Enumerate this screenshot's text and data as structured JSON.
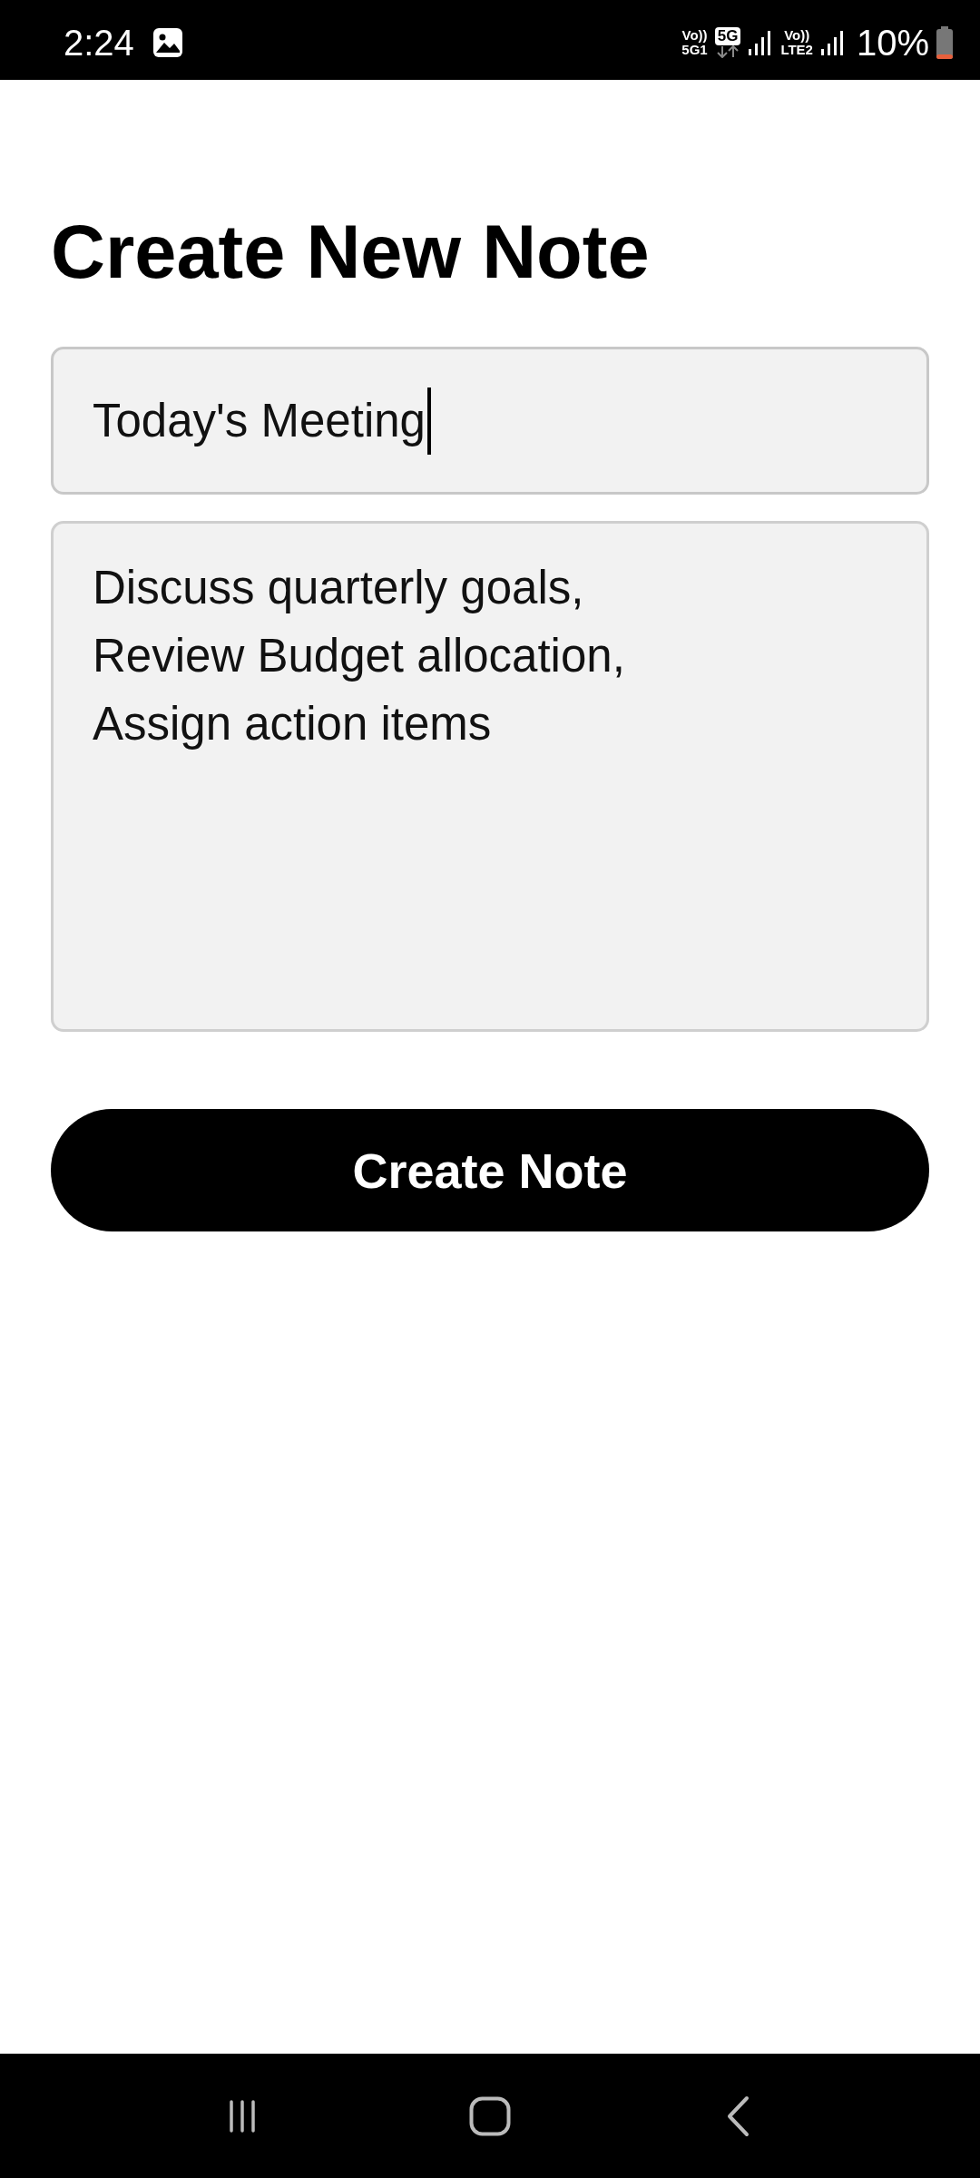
{
  "status_bar": {
    "time": "2:24",
    "sim_1": {
      "top": "Vo))",
      "bottom": "5G1"
    },
    "network": "5G",
    "sim_2": {
      "top": "Vo))",
      "bottom": "LTE2"
    },
    "battery": "10%"
  },
  "title": "Create New Note",
  "title_field": {
    "value": "Today's Meeting",
    "focused": true
  },
  "content_field": {
    "value": "Discuss quarterly goals,\nReview Budget allocation,\nAssign action items",
    "focused": false
  },
  "button": "Create Note"
}
